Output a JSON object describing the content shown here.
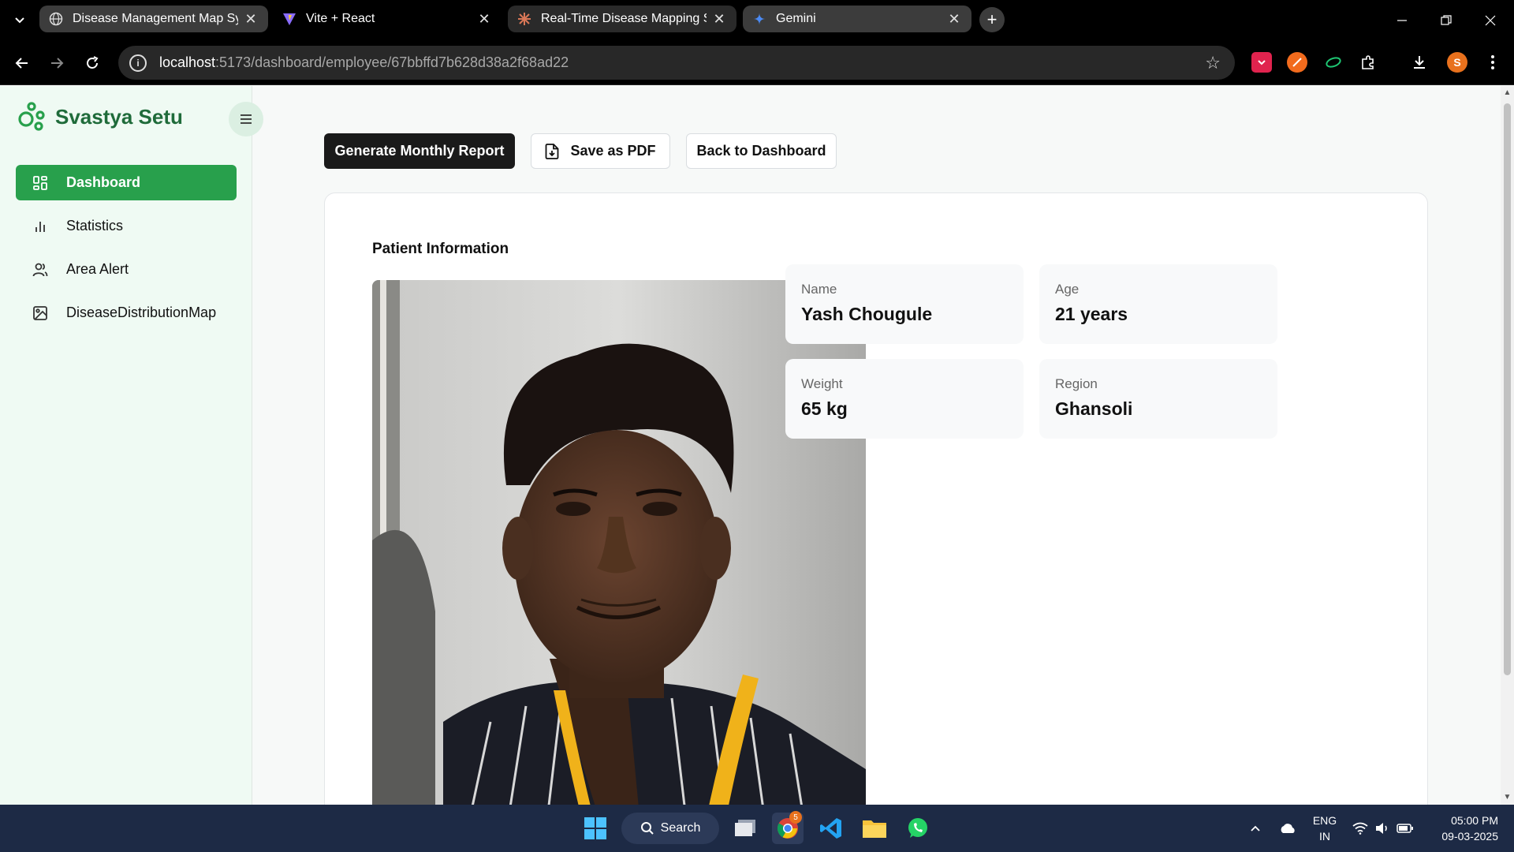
{
  "browser": {
    "tabs": [
      {
        "title": "Disease Management Map Syst",
        "active": true
      },
      {
        "title": "Vite + React",
        "active": false
      },
      {
        "title": "Real-Time Disease Mapping Sys",
        "active": false
      },
      {
        "title": "Gemini",
        "active": false
      }
    ],
    "url_host": "localhost",
    "url_rest": ":5173/dashboard/employee/67bbffd7b628d38a2f68ad22",
    "profile_initial": "S"
  },
  "sidebar": {
    "brand": "Svastya Setu",
    "items": [
      {
        "label": "Dashboard",
        "icon": "dashboard-grid-icon",
        "active": true
      },
      {
        "label": "Statistics",
        "icon": "bar-chart-icon",
        "active": false
      },
      {
        "label": "Area Alert",
        "icon": "users-icon",
        "active": false
      },
      {
        "label": "DiseaseDistributionMap",
        "icon": "image-icon",
        "active": false
      }
    ]
  },
  "toolbar": {
    "generate_label": "Generate Monthly Report",
    "pdf_label": "Save as PDF",
    "back_label": "Back to Dashboard"
  },
  "patient": {
    "heading": "Patient Information",
    "name_label": "Name",
    "name": "Yash Chougule",
    "age_label": "Age",
    "age": "21 years",
    "weight_label": "Weight",
    "weight": "65 kg",
    "region_label": "Region",
    "region": "Ghansoli"
  },
  "taskbar": {
    "search_label": "Search",
    "chrome_badge": "5",
    "lang_top": "ENG",
    "lang_bottom": "IN",
    "time": "05:00 PM",
    "date": "09-03-2025"
  },
  "colors": {
    "accent": "#28a04c",
    "brand_text": "#1f6b3a",
    "sidebar_bg": "#effaf3"
  }
}
